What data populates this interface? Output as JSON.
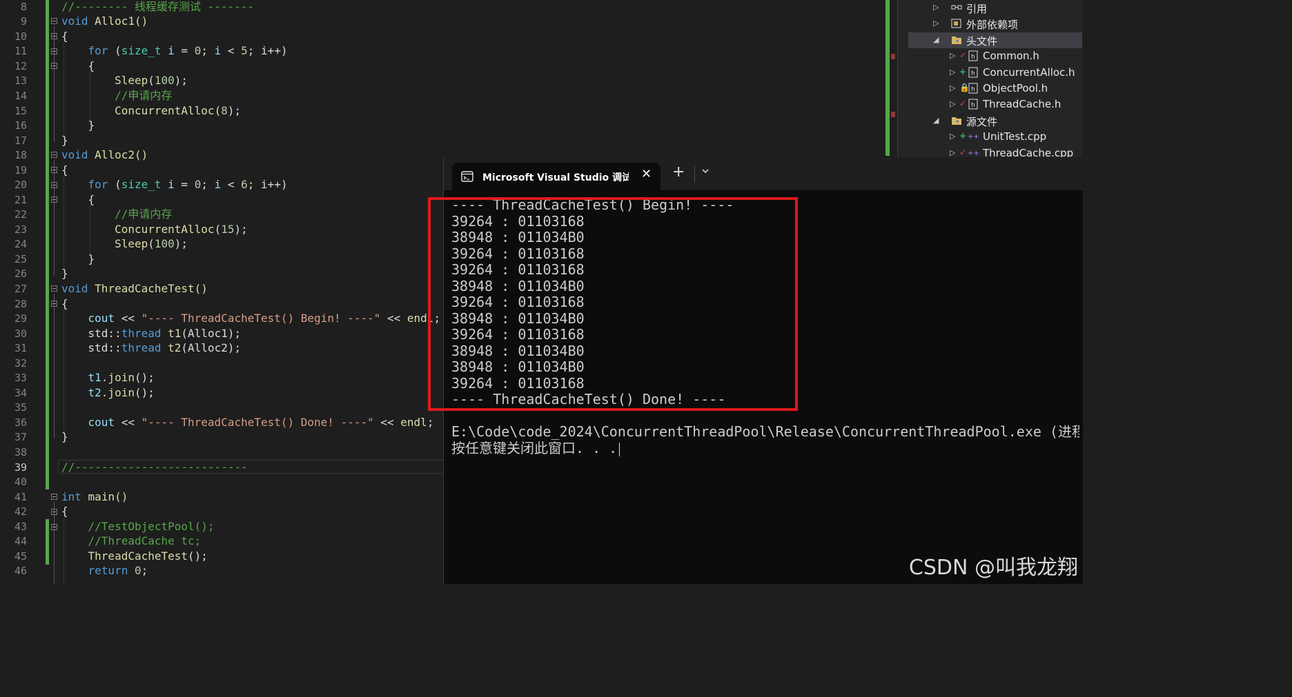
{
  "editor": {
    "line_numbers": [
      "8",
      "9",
      "10",
      "11",
      "12",
      "13",
      "14",
      "15",
      "16",
      "17",
      "18",
      "19",
      "20",
      "21",
      "22",
      "23",
      "24",
      "25",
      "26",
      "27",
      "28",
      "29",
      "30",
      "31",
      "32",
      "33",
      "34",
      "35",
      "36",
      "37",
      "38",
      "39",
      "40",
      "41",
      "42",
      "43",
      "44",
      "45",
      "46"
    ],
    "current_line": "39",
    "code": {
      "l8": "//-------- 线程缓存测试 -------",
      "l9_kw": "void",
      "l9_fn": "Alloc1()",
      "brace_open": "{",
      "brace_close": "}",
      "l11_for": "for",
      "l11_ty": "size_t",
      "l11_i": "i",
      "l11_eq": " = ",
      "l11_n0": "0",
      "l11_mid": "; ",
      "l11_i2": "i",
      "l11_lt": " < ",
      "l11_n5": "5",
      "l11_end": "; i++)",
      "l13_fn": "Sleep",
      "l13_n": "100",
      "l14": "//申请内存",
      "l15_fn": "ConcurrentAlloc",
      "l15_n": "8",
      "l18_kw": "void",
      "l18_fn": "Alloc2()",
      "l20_n6": "6",
      "l22": "//申请内存",
      "l23_fn": "ConcurrentAlloc",
      "l23_n": "15",
      "l24_fn": "Sleep",
      "l24_n": "100",
      "l27_kw": "void",
      "l27_fn": "ThreadCacheTest()",
      "l29_cout": "cout",
      "l29_op": " << ",
      "l29_str": "\"---- ThreadCacheTest() Begin! ----\"",
      "l29_endl": "endl",
      "l30_ns": "std::",
      "l30_ty": "thread",
      "l30_var": "t1",
      "l30_arg": "(Alloc1);",
      "l31_ns": "std::",
      "l31_ty": "thread",
      "l31_var": "t2",
      "l31_arg": "(Alloc2);",
      "l33_var": "t1",
      "l33_fn": ".join",
      "l33_end": "();",
      "l34_var": "t2",
      "l34_fn": ".join",
      "l34_end": "();",
      "l36_cout": "cout",
      "l36_op": " << ",
      "l36_str": "\"---- ThreadCacheTest() Done! ----\"",
      "l36_endl": "endl",
      "l39": "//--------------------------",
      "l41_kw": "int",
      "l41_fn": "main()",
      "l43": "//TestObjectPool();",
      "l44": "//ThreadCache tc;",
      "l45_fn": "ThreadCacheTest",
      "l45_end": "();",
      "l46_kw": "return",
      "l46_n": "0"
    }
  },
  "solution_explorer": {
    "items": [
      {
        "label": "引用",
        "icon": "references-icon"
      },
      {
        "label": "外部依赖项",
        "icon": "external-deps-icon"
      },
      {
        "label": "头文件",
        "icon": "filter-folder-icon"
      },
      {
        "label": "Common.h",
        "icon": "header-file-icon",
        "status": "✓",
        "status_color": "#e0433b"
      },
      {
        "label": "ConcurrentAlloc.h",
        "icon": "header-file-icon",
        "status": "+",
        "status_color": "#3cb371"
      },
      {
        "label": "ObjectPool.h",
        "icon": "header-file-icon",
        "status": "🔒",
        "status_color": "#4f8fd8"
      },
      {
        "label": "ThreadCache.h",
        "icon": "header-file-icon",
        "status": "✓",
        "status_color": "#e0433b"
      },
      {
        "label": "源文件",
        "icon": "filter-folder-icon"
      },
      {
        "label": "UnitTest.cpp",
        "icon": "cpp-file-icon",
        "status": "+",
        "status_color": "#3cb371"
      },
      {
        "label": "ThreadCache.cpp",
        "icon": "cpp-file-icon",
        "status": "✓",
        "status_color": "#e0433b"
      }
    ]
  },
  "terminal": {
    "tab_title": "Microsoft Visual Studio 调试控制台",
    "close_glyph": "✕",
    "new_tab_glyph": "+",
    "lines": [
      "---- ThreadCacheTest() Begin! ----",
      "39264 : 01103168",
      "38948 : 011034B0",
      "39264 : 01103168",
      "39264 : 01103168",
      "38948 : 011034B0",
      "39264 : 01103168",
      "38948 : 011034B0",
      "39264 : 01103168",
      "38948 : 011034B0",
      "38948 : 011034B0",
      "39264 : 01103168",
      "---- ThreadCacheTest() Done! ----"
    ],
    "exit_line": "E:\\Code\\code_2024\\ConcurrentThreadPool\\Release\\ConcurrentThreadPool.exe (进程",
    "prompt_line": "按任意键关闭此窗口. . ."
  },
  "watermark": "CSDN @叫我龙翔",
  "colors": {
    "highlight_border": "#e0191b",
    "change_bar": "#57a64a"
  }
}
